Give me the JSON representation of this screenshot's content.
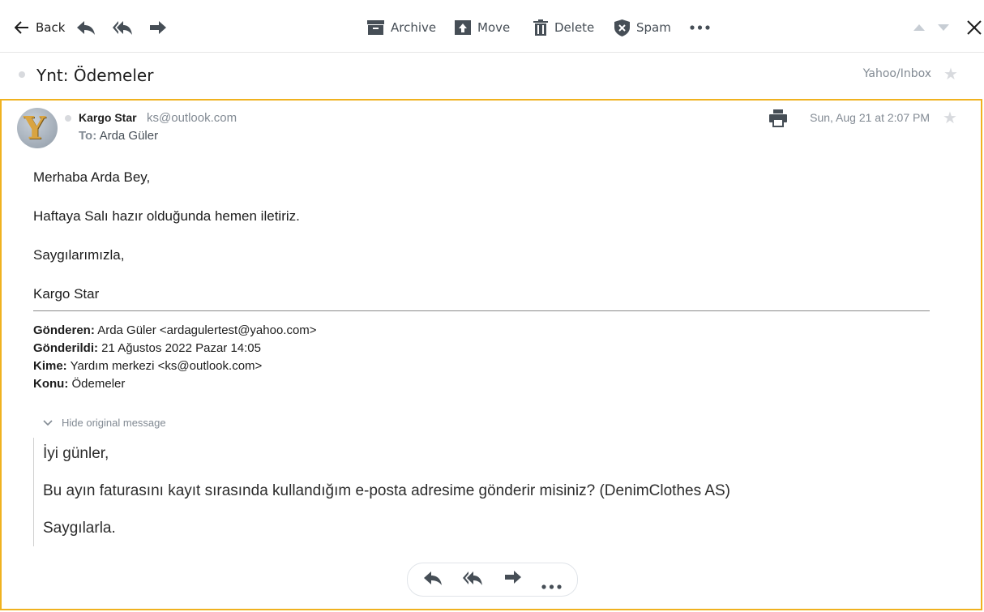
{
  "toolbar": {
    "back_label": "Back",
    "archive_label": "Archive",
    "move_label": "Move",
    "delete_label": "Delete",
    "spam_label": "Spam"
  },
  "header": {
    "subject": "Ynt: Ödemeler",
    "folder": "Yahoo/Inbox"
  },
  "message": {
    "avatar_letter": "Y",
    "sender_name": "Kargo Star",
    "sender_email": "ks@outlook.com",
    "to_label": "To:",
    "to_name": "Arda Güler",
    "date": "Sun, Aug 21 at 2:07 PM",
    "body": [
      "Merhaba Arda Bey,",
      "Haftaya Salı hazır olduğunda hemen iletiriz.",
      "Saygılarımızla,",
      "Kargo Star"
    ],
    "forward_header": {
      "from_label": "Gönderen:",
      "from_value": "Arda Güler <ardagulertest@yahoo.com>",
      "sent_label": "Gönderildi:",
      "sent_value": "21 Ağustos 2022 Pazar 14:05",
      "to_label": "Kime:",
      "to_value": "Yardım merkezi <ks@outlook.com>",
      "subject_label": "Konu:",
      "subject_value": "Ödemeler"
    },
    "hide_original_label": "Hide original message",
    "quoted": [
      "İyi günler,",
      "Bu ayın faturasını kayıt sırasında kullandığım e-posta adresime gönderir misiniz? (DenimClothes AS)",
      "Saygılarla."
    ]
  },
  "colors": {
    "accent_border": "#f0b21f",
    "icon_gray": "#464e56",
    "muted_text": "#828a93"
  }
}
